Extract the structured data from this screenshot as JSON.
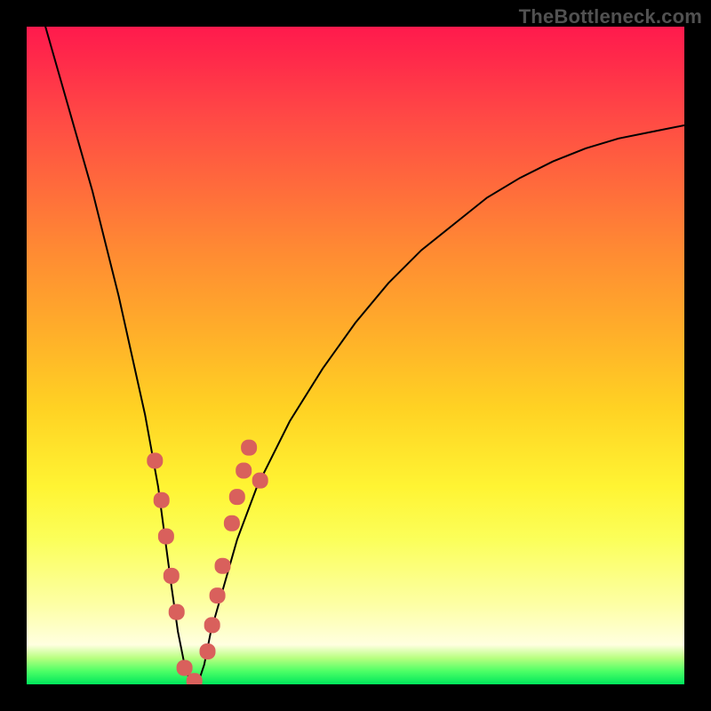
{
  "watermark": "TheBottleneck.com",
  "chart_data": {
    "type": "line",
    "title": "",
    "xlabel": "",
    "ylabel": "",
    "xlim": [
      0,
      100
    ],
    "ylim": [
      0,
      100
    ],
    "grid": false,
    "legend": false,
    "series": [
      {
        "name": "bottleneck-curve",
        "x": [
          0,
          2,
          4,
          6,
          8,
          10,
          12,
          14,
          16,
          18,
          20,
          22,
          23,
          24,
          25,
          26,
          27,
          28,
          30,
          32,
          35,
          40,
          45,
          50,
          55,
          60,
          65,
          70,
          75,
          80,
          85,
          90,
          95,
          100
        ],
        "y": [
          110,
          103,
          96,
          89,
          82,
          75,
          67,
          59,
          50,
          41,
          30,
          15,
          8,
          3,
          0,
          0,
          3,
          8,
          15,
          22,
          30,
          40,
          48,
          55,
          61,
          66,
          70,
          74,
          77,
          79.5,
          81.5,
          83,
          84,
          85
        ],
        "stroke": "#000000",
        "stroke_width": 2,
        "markers": false
      },
      {
        "name": "data-points",
        "x": [
          19.5,
          20.5,
          21.2,
          22.0,
          22.8,
          24.0,
          25.5,
          27.5,
          28.2,
          29.0,
          29.8,
          31.2,
          32.0,
          33.0,
          33.8,
          35.5
        ],
        "y": [
          34.0,
          28.0,
          22.5,
          16.5,
          11.0,
          2.5,
          0.5,
          5.0,
          9.0,
          13.5,
          18.0,
          24.5,
          28.5,
          32.5,
          36.0,
          31.0
        ],
        "stroke": "none",
        "marker_color": "#d9605c",
        "marker_shape": "rounded-rect",
        "marker_size": 18
      }
    ],
    "background_gradient": {
      "direction": "vertical",
      "stops": [
        {
          "pos": 0.0,
          "color": "#ff1a4d"
        },
        {
          "pos": 0.24,
          "color": "#ff6a3c"
        },
        {
          "pos": 0.58,
          "color": "#ffd223"
        },
        {
          "pos": 0.88,
          "color": "#fdffa6"
        },
        {
          "pos": 0.98,
          "color": "#4dff66"
        },
        {
          "pos": 1.0,
          "color": "#00e65c"
        }
      ]
    }
  }
}
